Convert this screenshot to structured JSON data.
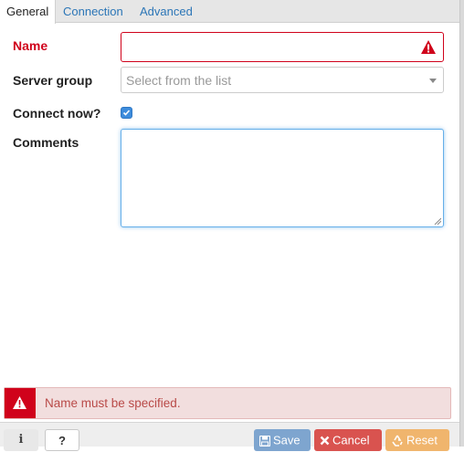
{
  "tabs": [
    {
      "label": "General",
      "active": true
    },
    {
      "label": "Connection",
      "active": false
    },
    {
      "label": "Advanced",
      "active": false
    }
  ],
  "form": {
    "name_label": "Name",
    "name_value": "",
    "server_group_label": "Server group",
    "server_group_placeholder": "Select from the list",
    "connect_now_label": "Connect now?",
    "connect_now_checked": true,
    "comments_label": "Comments",
    "comments_value": ""
  },
  "alert": {
    "message": "Name must be specified.",
    "icon": "warning-icon"
  },
  "footer": {
    "info_label": "i",
    "help_label": "?",
    "save_label": "Save",
    "cancel_label": "Cancel",
    "reset_label": "Reset"
  },
  "colors": {
    "error": "#d0021b",
    "link": "#2c76b7",
    "save": "#7ea5cf",
    "cancel": "#d9534f",
    "reset": "#f0b56d"
  }
}
